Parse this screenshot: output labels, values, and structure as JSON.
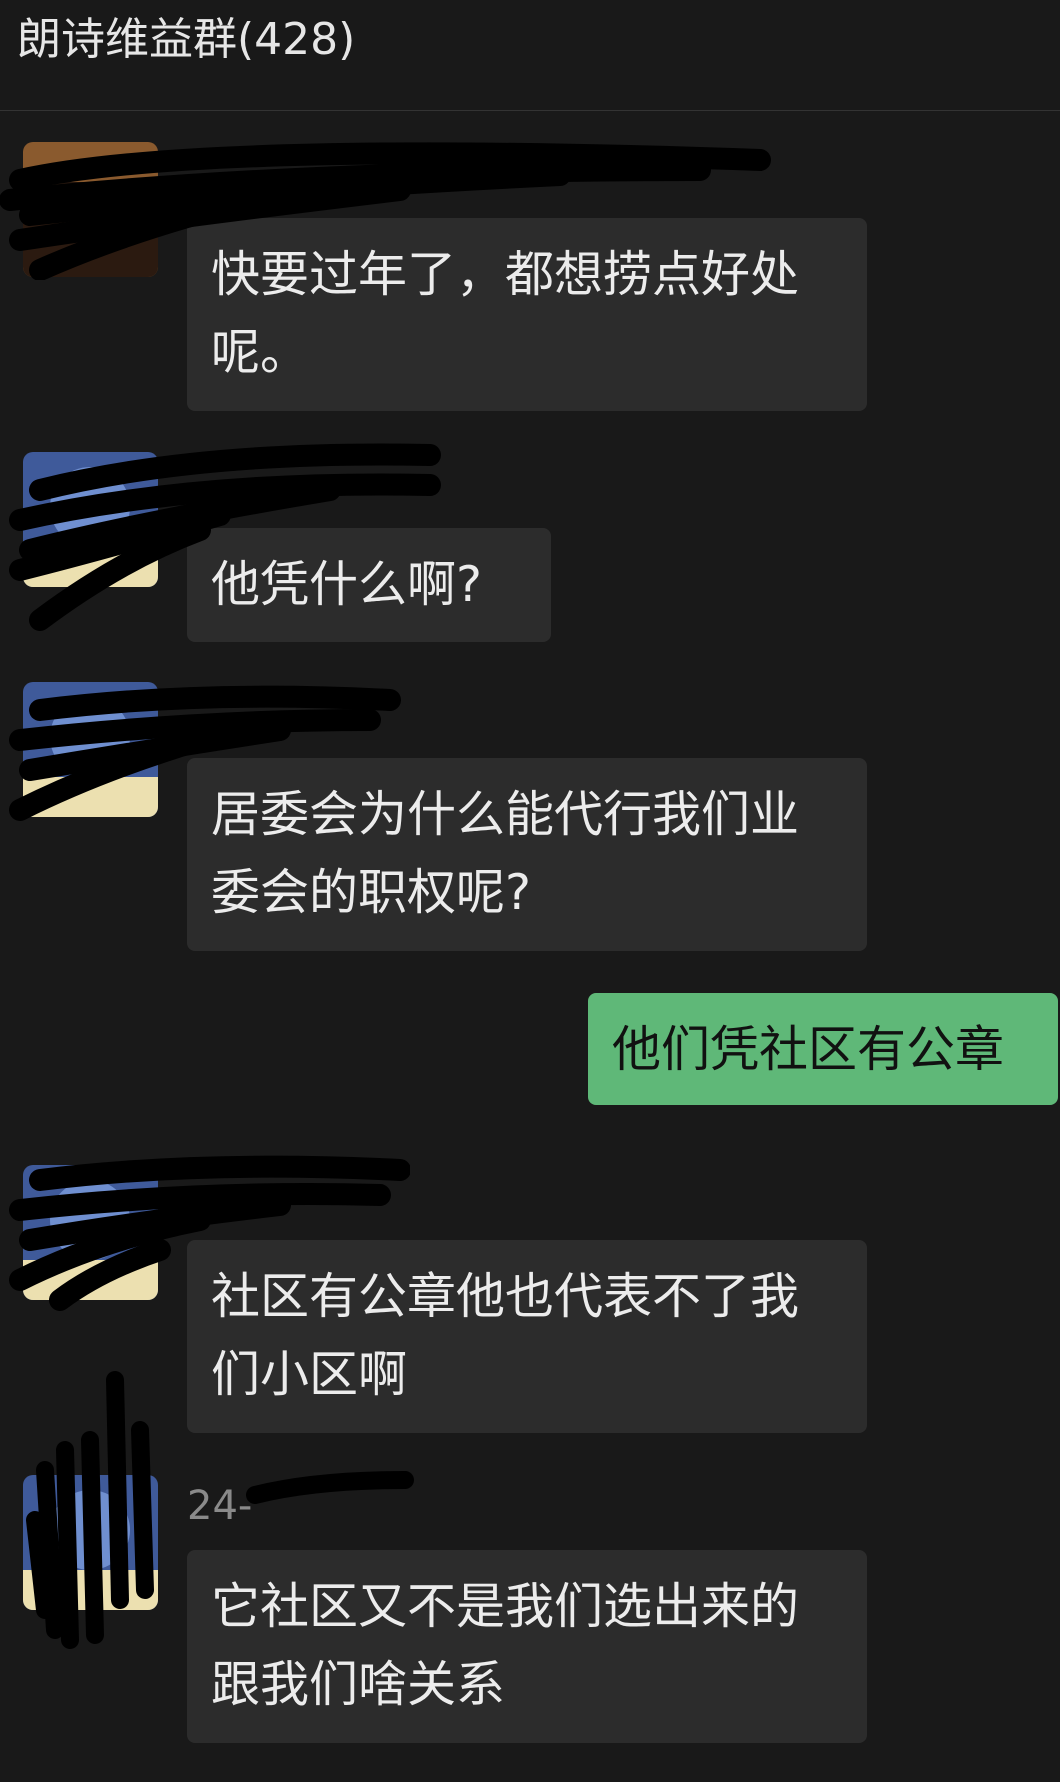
{
  "header": {
    "title": "朗诗维益群(428)"
  },
  "messages": [
    {
      "sender": "",
      "text": "快要过年了，都想捞点好处呢。",
      "mine": false
    },
    {
      "sender": "",
      "text": "他凭什么啊?",
      "mine": false
    },
    {
      "sender": "",
      "text": "居委会为什么能代行我们业委会的职权呢?",
      "mine": false
    },
    {
      "sender": "",
      "text": "他们凭社区有公章",
      "mine": true
    },
    {
      "sender": "",
      "text": "社区有公章他也代表不了我们小区啊",
      "mine": false
    },
    {
      "sender": "24-",
      "text": "它社区又不是我们选出来的跟我们啥关系",
      "mine": false
    }
  ],
  "colors": {
    "background": "#191919",
    "bubble_incoming": "#2c2c2c",
    "bubble_outgoing": "#5fb878",
    "text": "#ececec",
    "sender_text": "#8a8a8a",
    "redaction": "#000000"
  }
}
